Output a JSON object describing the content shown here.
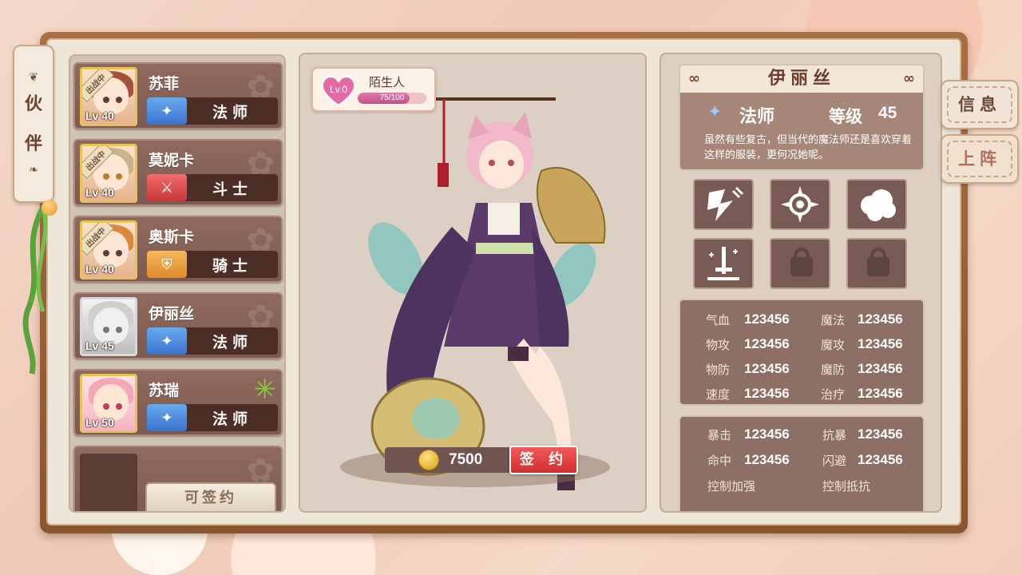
{
  "side_tab": {
    "label_1": "伙",
    "label_2": "伴"
  },
  "partners": [
    {
      "name": "苏菲",
      "level": "Lv 40",
      "class": "法师",
      "class_icon": "mage-flame-icon",
      "deployed": true
    },
    {
      "name": "莫妮卡",
      "level": "Lv 40",
      "class": "斗士",
      "class_icon": "fighter-sword-icon",
      "deployed": true
    },
    {
      "name": "奥斯卡",
      "level": "Lv 40",
      "class": "骑士",
      "class_icon": "knight-shield-icon",
      "deployed": true
    },
    {
      "name": "伊丽丝",
      "level": "Lv 45",
      "class": "法师",
      "class_icon": "mage-flame-icon",
      "deployed": false
    },
    {
      "name": "苏瑞",
      "level": "Lv 50",
      "class": "法师",
      "class_icon": "mage-flame-icon",
      "deployed": false
    }
  ],
  "deployed_badge": "出战中",
  "contract_slot": {
    "button": "可签约"
  },
  "affinity": {
    "level": "Lv.0",
    "relation": "陌生人",
    "current": 75,
    "max": 100,
    "text": "75/100"
  },
  "purchase": {
    "price": "7500",
    "button": "签 约"
  },
  "info": {
    "name": "伊丽丝",
    "class": "法师",
    "level_label": "等级",
    "level": "45",
    "description": "虽然有些复古，但当代的魔法师还是喜欢穿着这样的服装，更何况她呢。"
  },
  "skills": [
    "skill-strike-icon",
    "skill-burst-icon",
    "skill-cloud-icon",
    "skill-sword-icon",
    "lock-icon",
    "lock-icon"
  ],
  "stats": [
    {
      "label": "气血",
      "value": "123456"
    },
    {
      "label": "魔法",
      "value": "123456"
    },
    {
      "label": "物攻",
      "value": "123456"
    },
    {
      "label": "魔攻",
      "value": "123456"
    },
    {
      "label": "物防",
      "value": "123456"
    },
    {
      "label": "魔防",
      "value": "123456"
    },
    {
      "label": "速度",
      "value": "123456"
    },
    {
      "label": "治疗",
      "value": "123456"
    }
  ],
  "stats2": [
    {
      "label": "暴击",
      "value": "123456"
    },
    {
      "label": "抗暴",
      "value": "123456"
    },
    {
      "label": "命中",
      "value": "123456"
    },
    {
      "label": "闪避",
      "value": "123456"
    },
    {
      "label": "控制加强",
      "value": ""
    },
    {
      "label": "控制抵抗",
      "value": ""
    }
  ],
  "right_tabs": {
    "info": "信息",
    "deploy": "上阵"
  },
  "colors": {
    "mage": "#3b73cc",
    "fighter": "#c9363a",
    "knight": "#e08a2a",
    "contract": "#cf2e2e"
  }
}
